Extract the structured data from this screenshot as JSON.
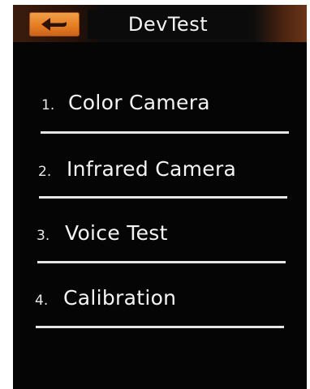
{
  "header": {
    "title": "DevTest",
    "back_icon": "back-arrow-icon"
  },
  "menu": {
    "items": [
      {
        "number": "1.",
        "label": "Color Camera"
      },
      {
        "number": "2.",
        "label": "Infrared Camera"
      },
      {
        "number": "3.",
        "label": "Voice Test"
      },
      {
        "number": "4.",
        "label": "Calibration"
      }
    ]
  },
  "colors": {
    "background": "#050505",
    "back_button": "#e67e22",
    "text": "#f4f4f4",
    "divider": "#e6e6e6"
  }
}
